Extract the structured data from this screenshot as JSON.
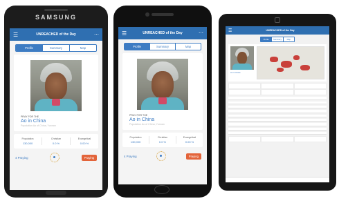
{
  "samsung": {
    "brand": "SAMSUNG"
  },
  "app": {
    "title": "UNREACHED of the Day",
    "menu_icon": "hamburger-menu-icon",
    "more_icon": "more-dots-icon",
    "tabs": [
      "Profile",
      "Summary",
      "Map"
    ],
    "active_tab": 0,
    "people_for_label": "PRAY FOR THE",
    "people_name": "Ao in China",
    "people_sub": "Population Ao of China, Yunnan",
    "stats": [
      {
        "label": "Population",
        "value": "130,000"
      },
      {
        "label": "Christian",
        "value": "0.0 %"
      },
      {
        "label": "Evangelical",
        "value": "0.00 %"
      }
    ],
    "praying_count": "4 Praying",
    "pray_button": "Praying"
  },
  "iphone": {
    "praying_count": "4 Praying",
    "pray_button": "Praying"
  },
  "colors": {
    "header_blue": "#2f6fb1",
    "accent_blue": "#3d7cc3",
    "pray_orange": "#e3643a"
  }
}
